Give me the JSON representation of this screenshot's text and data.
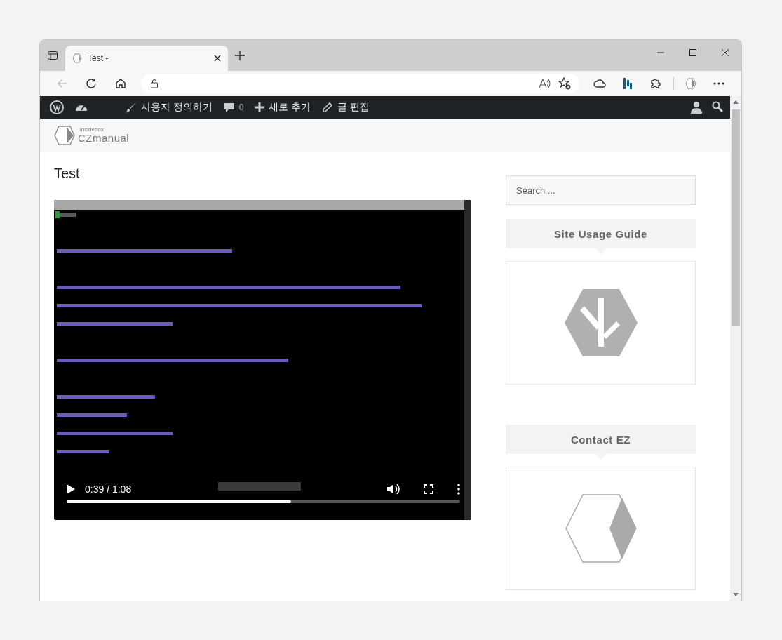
{
  "browser": {
    "tab": {
      "title": "Test -",
      "selected": true
    }
  },
  "admin_bar": {
    "items": [
      {
        "kind": "customize",
        "label": "사용자 정의하기"
      },
      {
        "kind": "comments",
        "label": "0"
      },
      {
        "kind": "new",
        "label": "새로 추가"
      },
      {
        "kind": "edit",
        "label": "글 편집"
      }
    ]
  },
  "site": {
    "logo_small": "insidebox",
    "logo_large": "CZmanual"
  },
  "post": {
    "title": "Test",
    "video": {
      "time": "0:39 / 1:08",
      "level": 0.57
    }
  },
  "sidebar": {
    "search": {
      "placeholder": "Search ..."
    },
    "widgets": [
      {
        "title": "Site Usage Guide",
        "kind": "tree"
      },
      {
        "title": "Contact EZ",
        "kind": "cube"
      }
    ]
  }
}
